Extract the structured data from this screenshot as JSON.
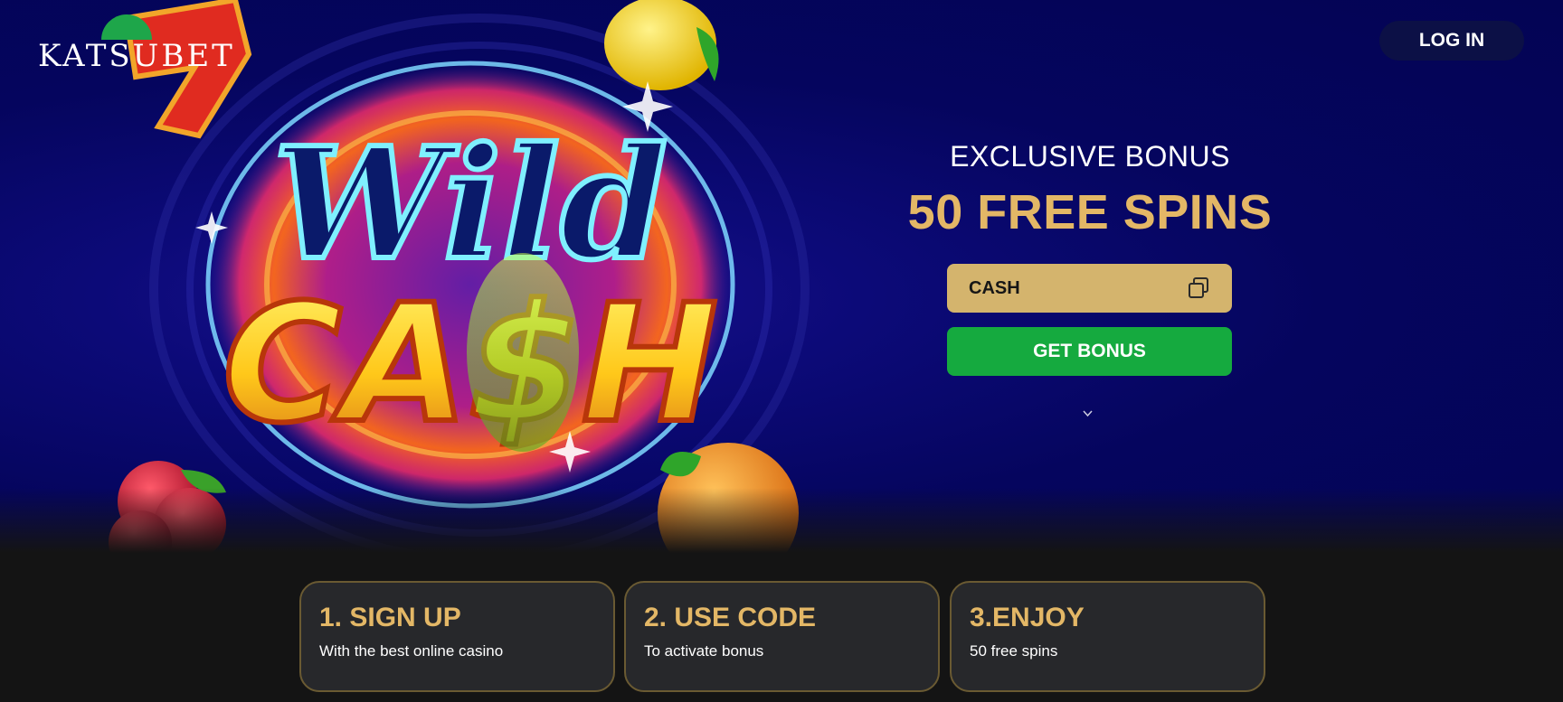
{
  "brand": {
    "logo_text": "KATSUBET",
    "accent": "#1ea64a"
  },
  "header": {
    "login_label": "LOG IN"
  },
  "hero": {
    "game_title_line1": "Wild",
    "game_title_line2": "CA$H"
  },
  "promo": {
    "eyebrow": "EXCLUSIVE BONUS",
    "headline": "50 FREE SPINS",
    "code": "CASH",
    "copy_icon": "copy-icon",
    "cta_label": "GET BONUS"
  },
  "steps": [
    {
      "title": "1. SIGN UP",
      "subtitle": "With the best online casino"
    },
    {
      "title": "2. USE CODE",
      "subtitle": "To activate bonus"
    },
    {
      "title": "3.ENJOY",
      "subtitle": "50 free spins"
    }
  ],
  "colors": {
    "gold": "#e3b766",
    "code_box": "#d4b46d",
    "cta_green": "#15aa3f",
    "hero_bg": "#05055e",
    "footer_bg": "#141414"
  }
}
